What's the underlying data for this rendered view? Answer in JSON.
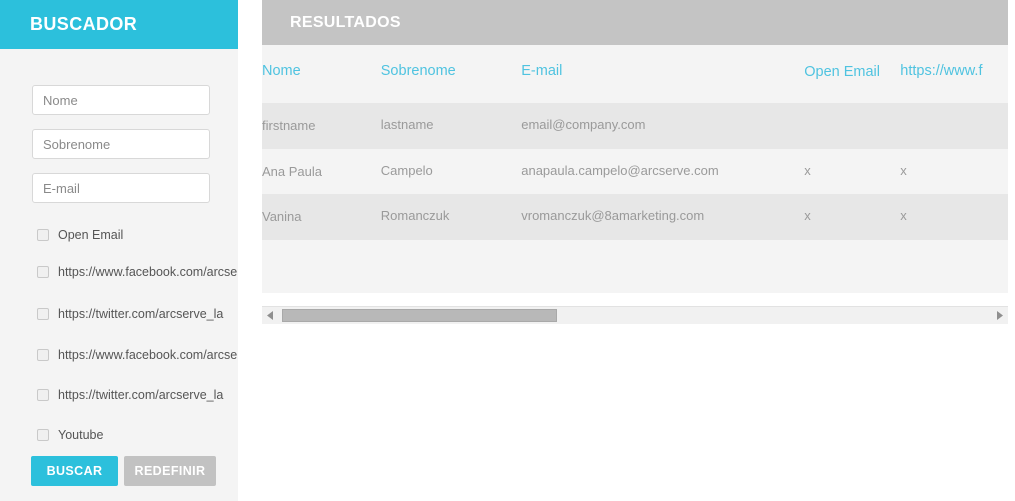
{
  "search_panel": {
    "title": "BUSCADOR",
    "fields": [
      {
        "name": "nome",
        "value": "",
        "placeholder": "Nome"
      },
      {
        "name": "sobrenome",
        "value": "",
        "placeholder": "Sobrenome"
      },
      {
        "name": "email",
        "value": "",
        "placeholder": "E-mail"
      }
    ],
    "checkboxes": [
      {
        "label": "Open Email",
        "checked": false
      },
      {
        "label": "https://www.facebook.com/arcservela",
        "checked": false
      },
      {
        "label": "https://twitter.com/arcserve_la",
        "checked": false
      },
      {
        "label": "https://www.facebook.com/arcservela",
        "checked": false
      },
      {
        "label": "https://twitter.com/arcserve_la",
        "checked": false
      },
      {
        "label": "Youtube",
        "checked": false
      }
    ],
    "buttons": {
      "search_label": "BUSCAR",
      "reset_label": "REDEFINIR"
    }
  },
  "results": {
    "title": "RESULTADOS",
    "columns": [
      "Nome",
      "Sobrenome",
      "E-mail",
      "Open Email",
      "https://www.f"
    ],
    "rows": [
      {
        "nome": "firstname",
        "sobrenome": "lastname",
        "email": "email@company.com",
        "open_email": "",
        "facebook": ""
      },
      {
        "nome": "Ana Paula",
        "sobrenome": "Campelo",
        "email": "anapaula.campelo@arcserve.com",
        "open_email": "x",
        "facebook": "x"
      },
      {
        "nome": "Vanina",
        "sobrenome": "Romanczuk",
        "email": "vromanczuk@8amarketing.com",
        "open_email": "x",
        "facebook": "x"
      }
    ],
    "scrollbar": {
      "left_arrow": "triangle-left-icon",
      "right_arrow": "triangle-right-icon"
    }
  },
  "colors": {
    "accent_cyan": "#2cc0dc",
    "header_gray": "#c4c4c4",
    "panel_gray": "#f4f4f4",
    "row_alt_gray": "#e7e7e7",
    "button_gray": "#c2c2c2",
    "column_header_cyan": "#4fc3e0"
  }
}
